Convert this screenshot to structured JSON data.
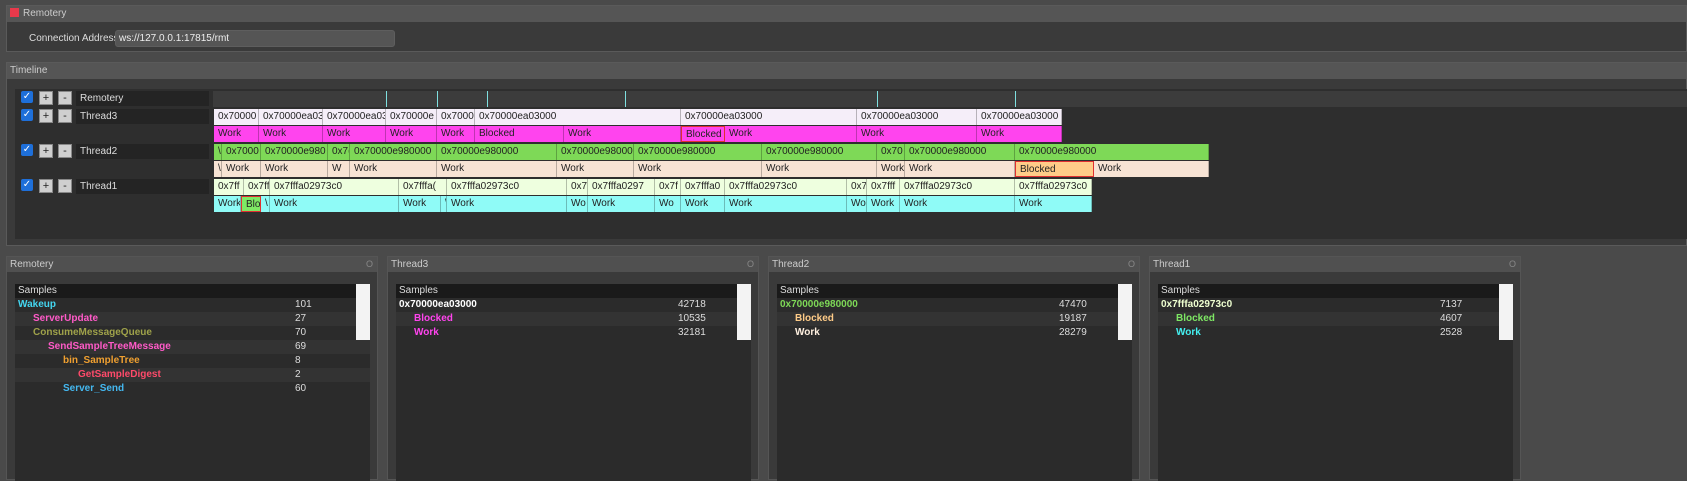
{
  "app": {
    "title": "Remotery",
    "close_color": "#e8394b"
  },
  "connection": {
    "label": "Connection Address",
    "value": "ws://127.0.0.1:17815/rmt"
  },
  "timeline": {
    "title": "Timeline",
    "rows": [
      {
        "name": "Remotery",
        "checked": "✓",
        "plus": "+",
        "minus": "-"
      },
      {
        "name": "Thread3",
        "checked": "✓",
        "plus": "+",
        "minus": "-"
      },
      {
        "name": "Thread2",
        "checked": "✓",
        "plus": "+",
        "minus": "-"
      },
      {
        "name": "Thread1",
        "checked": "✓",
        "plus": "+",
        "minus": "-"
      }
    ],
    "thread3_top": [
      "0x70000",
      "0x70000ea03",
      "0x70000ea03",
      "0x70000e",
      "0x7000(",
      "0x70000ea03000",
      "0x70000ea03000",
      "0x70000ea03000",
      "0x70000ea03000"
    ],
    "thread3_bottom": [
      "Work",
      "Work",
      "Work",
      "Work",
      "Work",
      "Blocked",
      "Work",
      "Blocked",
      "Work",
      "Work",
      "Work"
    ],
    "thread2_top": [
      "\\",
      "0x7000",
      "0x70000e980",
      "0x7(",
      "0x70000e980000",
      "0x70000e980000",
      "0x70000e98000",
      "0x70000e980000",
      "0x70000e980000",
      "0x70",
      "0x70000e980000",
      "0x70000e980000"
    ],
    "thread2_bottom": [
      "\\",
      "Work",
      "Work",
      "W",
      "Work",
      "Work",
      "Work",
      "Work",
      "Work",
      "Work",
      "Work",
      "Blocked",
      "Work"
    ],
    "thread1_top": [
      "0x7ff",
      "0x7ff",
      "0x7fffa02973c0",
      "0x7fffa(",
      "0x7fffa02973c0",
      "0x7",
      "0x7fffa0297",
      "0x7f",
      "0x7fffa0",
      "0x7fffa02973c0",
      "0x7",
      "0x7fff",
      "0x7fffa02973c0",
      "0x7fffa02973c0"
    ],
    "thread1_bottom": [
      "Work",
      "Blo",
      "\\",
      "Work",
      "Work",
      "\\",
      "Work",
      "Wo",
      "Work",
      "Wo",
      "Work",
      "Work",
      "Wo",
      "Work",
      "Work",
      "Work"
    ]
  },
  "panels": [
    {
      "title": "Remotery",
      "close": "O",
      "header": "Samples",
      "rows": [
        {
          "name": "Wakeup",
          "value": "101",
          "indent": 0,
          "color": "#44d6f0"
        },
        {
          "name": "ServerUpdate",
          "value": "27",
          "indent": 1,
          "color": "#ff5ac8"
        },
        {
          "name": "ConsumeMessageQueue",
          "value": "70",
          "indent": 1,
          "color": "#9fa24a"
        },
        {
          "name": "SendSampleTreeMessage",
          "value": "69",
          "indent": 2,
          "color": "#ff5ac8"
        },
        {
          "name": "bin_SampleTree",
          "value": "8",
          "indent": 3,
          "color": "#f0a030"
        },
        {
          "name": "GetSampleDigest",
          "value": "2",
          "indent": 4,
          "color": "#ff4a6a"
        },
        {
          "name": "Server_Send",
          "value": "60",
          "indent": 3,
          "color": "#44b8f0"
        }
      ]
    },
    {
      "title": "Thread3",
      "close": "O",
      "header": "Samples",
      "rows": [
        {
          "name": "0x70000ea03000",
          "value": "42718",
          "indent": 0,
          "color": "#ffffff"
        },
        {
          "name": "Blocked",
          "value": "10535",
          "indent": 1,
          "color": "#ff44ee"
        },
        {
          "name": "Work",
          "value": "32181",
          "indent": 1,
          "color": "#ff44ee"
        }
      ]
    },
    {
      "title": "Thread2",
      "close": "O",
      "header": "Samples",
      "rows": [
        {
          "name": "0x70000e980000",
          "value": "47470",
          "indent": 0,
          "color": "#7ed957"
        },
        {
          "name": "Blocked",
          "value": "19187",
          "indent": 1,
          "color": "#ffcc88"
        },
        {
          "name": "Work",
          "value": "28279",
          "indent": 1,
          "color": "#fff0e0"
        }
      ]
    },
    {
      "title": "Thread1",
      "close": "O",
      "header": "Samples",
      "rows": [
        {
          "name": "0x7fffa02973c0",
          "value": "7137",
          "indent": 0,
          "color": "#eeffd0"
        },
        {
          "name": "Blocked",
          "value": "4607",
          "indent": 1,
          "color": "#7ee864"
        },
        {
          "name": "Work",
          "value": "2528",
          "indent": 1,
          "color": "#44f0f0"
        }
      ]
    }
  ]
}
